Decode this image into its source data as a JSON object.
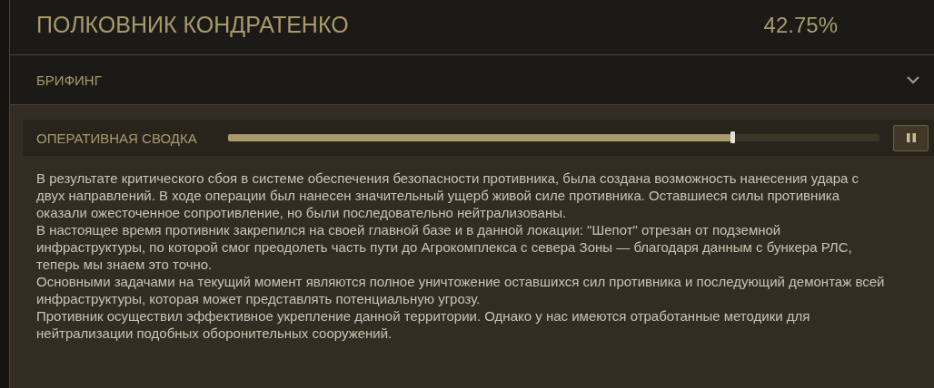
{
  "header": {
    "title": "ПОЛКОВНИК КОНДРАТЕНКО",
    "success_value": "42.75%"
  },
  "briefing": {
    "label": "БРИФИНГ",
    "expanded": true
  },
  "player": {
    "title": "ОПЕРАТИВНАЯ СВОДКА",
    "level": 0.775,
    "playing": true
  },
  "paragraphs": [
    "В результате критического сбоя в системе обеспечения безопасности противника, была создана возможность нанесения удара с двух направлений. В ходе операции был нанесен значительный ущерб живой силе противника. Оставшиеся силы противника оказали ожесточенное сопротивление, но были последовательно нейтрализованы.",
    "В настоящее время противник закрепился на своей главной базе и в данной локации: \"Шепот\" отрезан от подземной инфраструктуры, по которой смог преодолеть часть пути до Агрокомплекса с севера Зоны — благодаря данным с бункера РЛС, теперь мы знаем это точно.",
    "Основными задачами на текущий момент являются полное уничтожение оставшихся сил противника и последующий демонтаж всей инфраструктуры, которая может представлять потенциальную угрозу.",
    "Противник осуществил эффективное укрепление данной территории. Однако у нас имеются отработанные методики для нейтрализации подобных оборонительных сооружений."
  ]
}
